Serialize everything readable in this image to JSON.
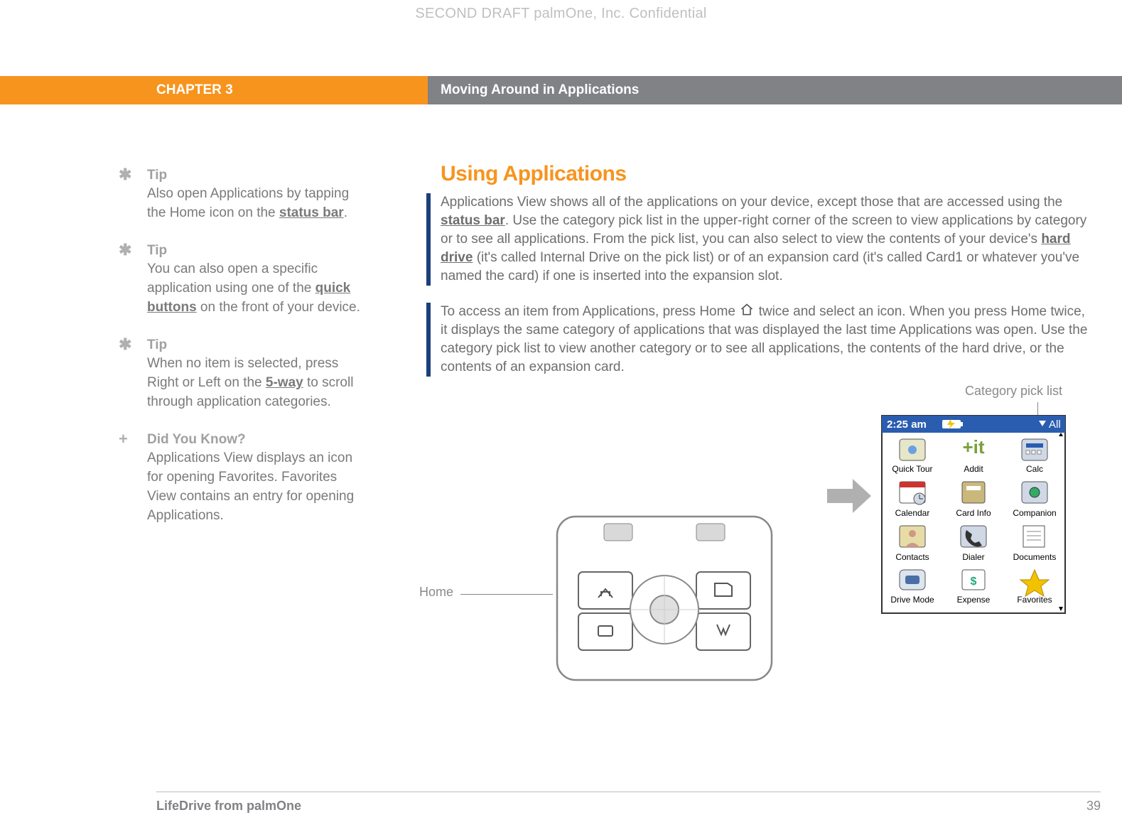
{
  "watermark": "SECOND DRAFT palmOne, Inc.  Confidential",
  "header": {
    "chapter": "CHAPTER 3",
    "title": "Moving Around in Applications"
  },
  "sidebar": {
    "tips": [
      {
        "icon": "✱",
        "label": "Tip",
        "body_pre": "Also open Applications by tapping the Home icon on the ",
        "link": "status bar",
        "body_post": "."
      },
      {
        "icon": "✱",
        "label": "Tip",
        "body_pre": "You can also open a specific application using one of the ",
        "link": "quick buttons",
        "body_post": " on the front of your device."
      },
      {
        "icon": "✱",
        "label": "Tip",
        "body_pre": "When no item is selected, press Right or Left on the ",
        "link": "5-way",
        "body_post": " to scroll through application categories."
      },
      {
        "icon": "+",
        "label": "Did You Know?",
        "body_pre": "Applications View displays an icon for opening Favorites. Favorites View contains an entry for opening Applications.",
        "link": "",
        "body_post": ""
      }
    ]
  },
  "main": {
    "heading": "Using Applications",
    "para1_a": "Applications View shows all of the applications on your device, except those that are accessed using the ",
    "para1_link1": "status bar",
    "para1_b": ". Use the category pick list in the upper-right corner of the screen to view applications by category or to see all applications. From the pick list, you can also select to view the contents of your device's ",
    "para1_link2": "hard drive",
    "para1_c": " (it's called Internal Drive on the pick list) or of an expansion card (it's called Card1 or whatever you've named the card) if one is inserted into the expansion slot.",
    "para2_a": "To access an item from Applications, press Home ",
    "para2_b": " twice and select an icon. When you press Home twice, it displays the same category of applications that was displayed the last time Applications was open. Use the category pick list to view another category or to see all applications, the contents of the hard drive, or the contents of an expansion card.",
    "labels": {
      "home": "Home",
      "category": "Category pick list"
    },
    "screen": {
      "time": "2:25 am",
      "pick": "All",
      "apps": [
        [
          "Quick Tour",
          "Addit",
          "Calc"
        ],
        [
          "Calendar",
          "Card Info",
          "Companion"
        ],
        [
          "Contacts",
          "Dialer",
          "Documents"
        ],
        [
          "Drive Mode",
          "Expense",
          "Favorites"
        ]
      ]
    }
  },
  "footer": {
    "product": "LifeDrive from palmOne",
    "page": "39"
  }
}
